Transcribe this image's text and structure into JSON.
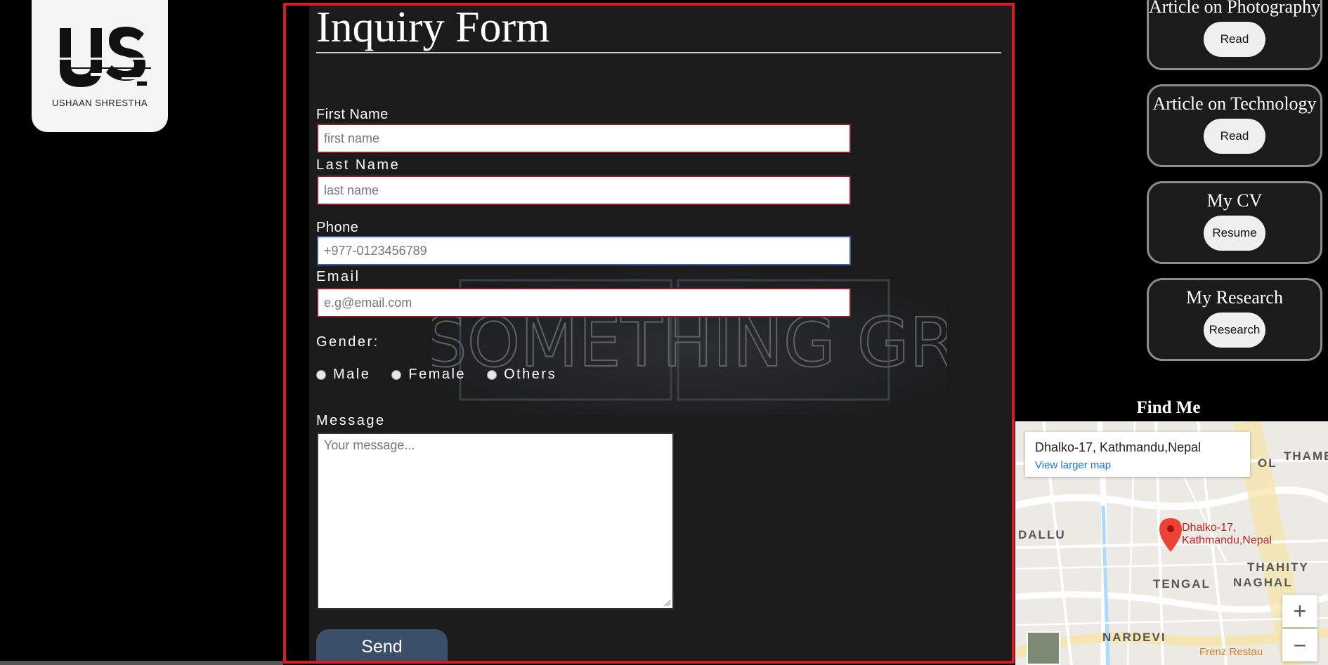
{
  "logo": {
    "name": "USHAAN SHRESTHA",
    "mark": "US"
  },
  "form": {
    "title": "Inquiry Form",
    "first_name": {
      "label": "First Name",
      "placeholder": "first name"
    },
    "last_name": {
      "label": "Last Name",
      "placeholder": "last name"
    },
    "phone": {
      "label": "Phone",
      "placeholder": "+977-0123456789"
    },
    "email": {
      "label": "Email",
      "placeholder": "e.g@email.com"
    },
    "gender": {
      "label": "Gender:",
      "options": [
        "Male",
        "Female",
        "Others"
      ]
    },
    "message": {
      "label": "Message",
      "placeholder": "Your message..."
    },
    "send_label": "Send",
    "background_sign": "DO SOMETHING GREAT"
  },
  "cards": [
    {
      "title": "Article on Photography",
      "button": "Read"
    },
    {
      "title": "Article on Technology",
      "button": "Read"
    },
    {
      "title": "My CV",
      "button": "Resume"
    },
    {
      "title": "My Research",
      "button": "Research"
    }
  ],
  "find_me": "Find Me",
  "map": {
    "place": "Dhalko-17, Kathmandu,Nepal",
    "link": "View larger map",
    "pin_label_line1": "Dhalko-17,",
    "pin_label_line2": "Kathmandu,Nepal",
    "labels": [
      "DALLU",
      "THAHITY",
      "TENGAL",
      "NAGHAL",
      "NARDEVI",
      "THAME",
      "OL"
    ],
    "restaurant": "Frenz Restau",
    "zoom_in": "+",
    "zoom_out": "−",
    "colors": {
      "pin": "#ea4335",
      "road": "#ffffff",
      "water": "#aadaff",
      "major_road": "#f7e4a6"
    }
  }
}
